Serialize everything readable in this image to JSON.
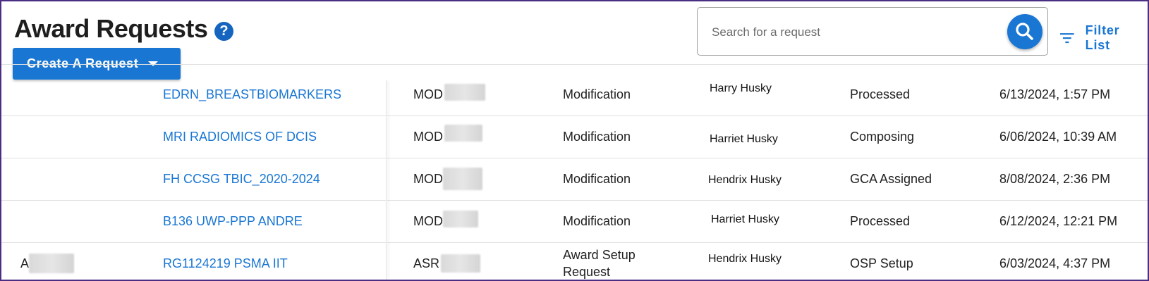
{
  "page": {
    "title": "Award Requests",
    "help_glyph": "?",
    "create_button": "Create A Request",
    "search_placeholder": "Search for a request",
    "filter_label": "Filter List"
  },
  "colors": {
    "accent": "#1976d2",
    "frame_border": "#4b2e83",
    "link": "#1976d2"
  },
  "icons": {
    "help": "help-circle-icon",
    "dropdown": "caret-down-icon",
    "search": "search-icon",
    "filter": "filter-lines-icon"
  },
  "rows": [
    {
      "prefix": "",
      "name": "EDRN_BREASTBIOMARKERS",
      "id_prefix": "MOD",
      "type": "Modification",
      "person": "Harry Husky",
      "status": "Processed",
      "date": "6/13/2024, 1:57 PM"
    },
    {
      "prefix": "",
      "name": "MRI RADIOMICS OF DCIS",
      "id_prefix": "MOD",
      "type": "Modification",
      "person": "Harriet Husky",
      "status": "Composing",
      "date": "6/06/2024, 10:39 AM"
    },
    {
      "prefix": "",
      "name": "FH CCSG TBIC_2020-2024",
      "id_prefix": "MOD",
      "type": "Modification",
      "person": "Hendrix Husky",
      "status": "GCA Assigned",
      "date": "8/08/2024, 2:36 PM"
    },
    {
      "prefix": "",
      "name": "B136 UWP-PPP ANDRE",
      "id_prefix": "MOD",
      "type": "Modification",
      "person": "Harriet Husky",
      "status": "Processed",
      "date": "6/12/2024, 12:21 PM"
    },
    {
      "prefix": "A",
      "name": "RG1124219 PSMA IIT",
      "id_prefix": "ASR",
      "type_line1": "Award Setup",
      "type_line2": "Request",
      "person": "Hendrix Husky",
      "status": "OSP Setup",
      "date": "6/03/2024, 4:37 PM"
    }
  ]
}
